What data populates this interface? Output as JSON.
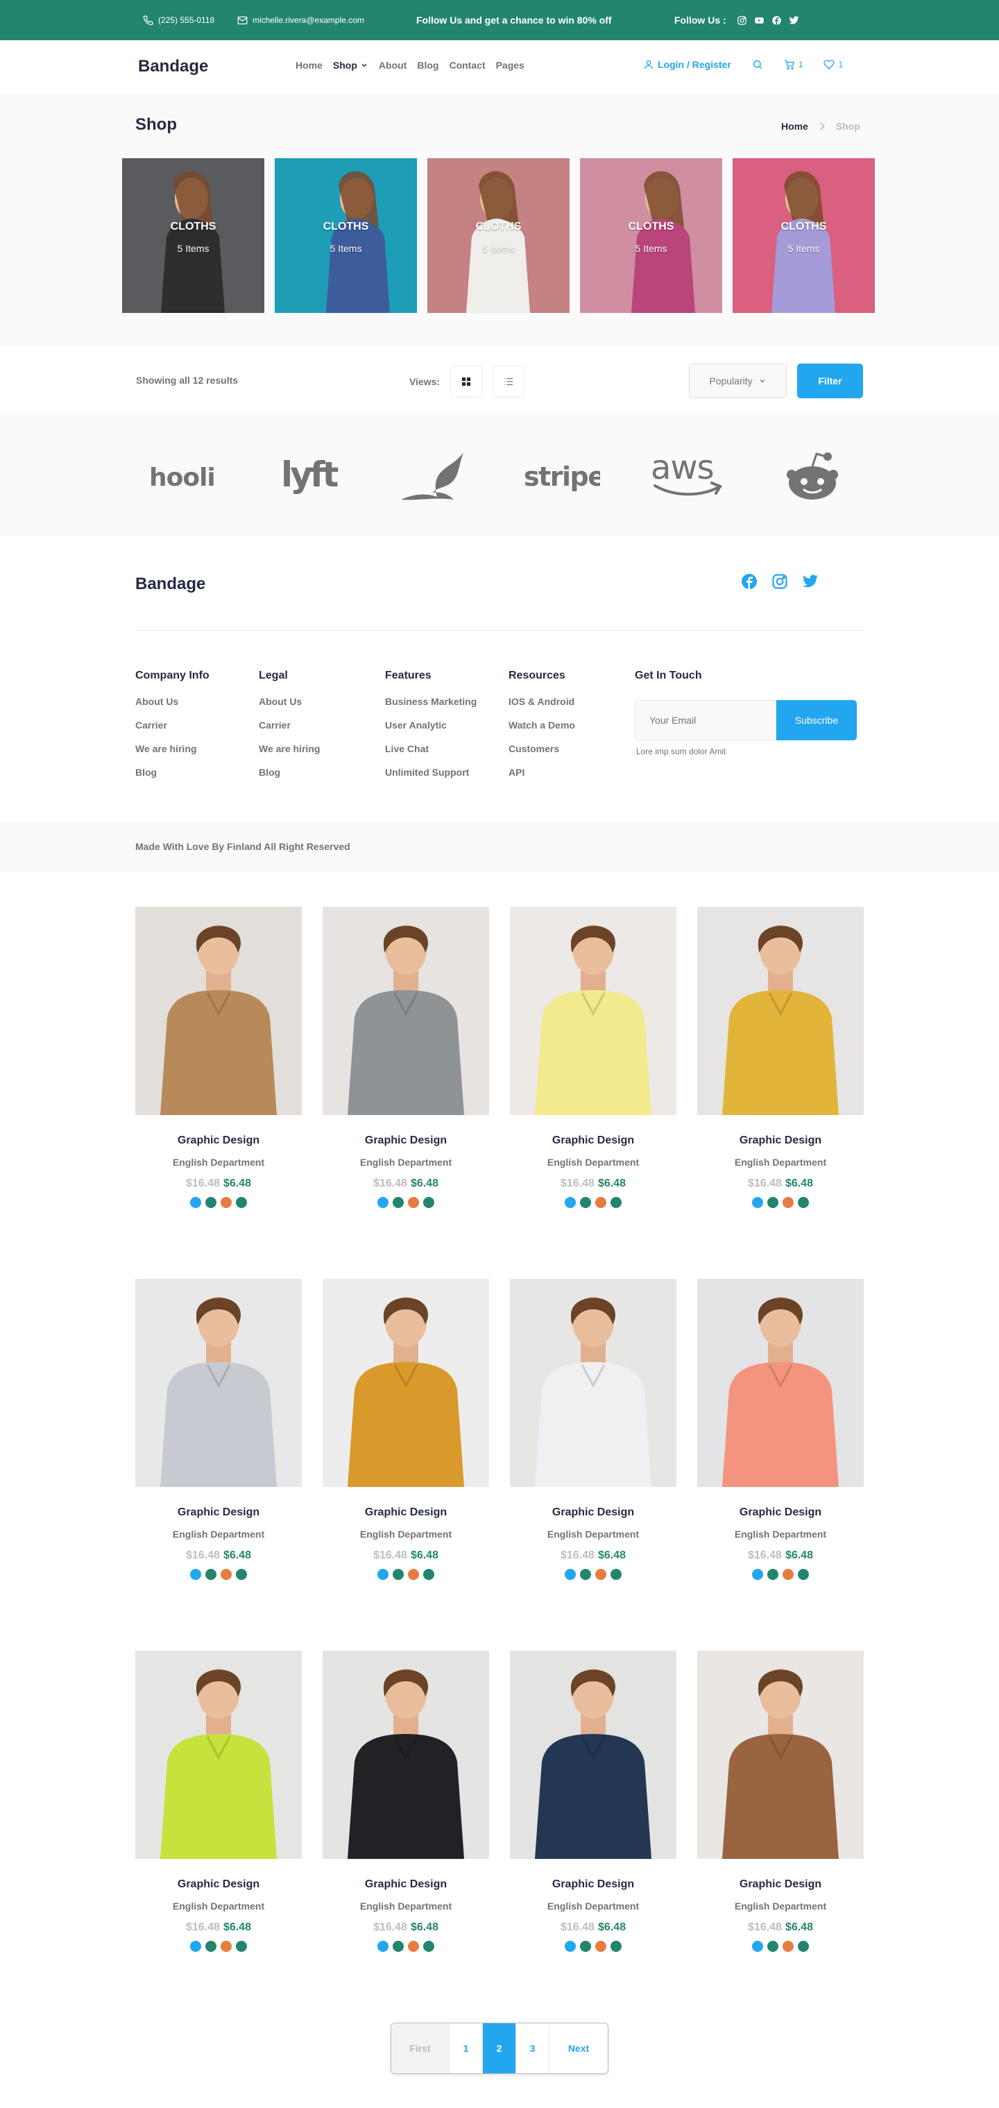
{
  "topbar": {
    "phone": "(225) 555-0118",
    "email": "michelle.rivera@example.com",
    "promo": "Follow Us  and get a chance to win 80% off",
    "follow": "Follow Us  :",
    "social_icons": [
      "instagram-icon",
      "youtube-icon",
      "facebook-icon",
      "twitter-icon"
    ]
  },
  "nav": {
    "brand": "Bandage",
    "items": [
      "Home",
      "Shop",
      "About",
      "Blog",
      "Contact",
      "Pages"
    ],
    "login": "Login / Register",
    "cart_count": "1",
    "wishlist_count": "1"
  },
  "hero": {
    "title": "Shop",
    "breadcrumb": [
      "Home",
      "Shop"
    ],
    "categories": [
      {
        "title": "CLOTHS",
        "count": "5 Items",
        "bg": "#5A5B5E"
      },
      {
        "title": "CLOTHS",
        "count": "5 Items",
        "bg": "#1E9DB6"
      },
      {
        "title": "CLOTHS",
        "count": "5 Items",
        "bg": "#C48282"
      },
      {
        "title": "CLOTHS",
        "count": "5 Items",
        "bg": "#D08FA0"
      },
      {
        "title": "CLOTHS",
        "count": "5 Items",
        "bg": "#D9607E"
      }
    ]
  },
  "filterbar": {
    "showing": "Showing all 12 results",
    "views_label": "Views:",
    "sort": "Popularity",
    "filter": "Filter"
  },
  "logos": [
    "hooli",
    "lyft",
    "leaf",
    "stripe",
    "aws",
    "reddit"
  ],
  "footer": {
    "brand": "Bandage",
    "columns": [
      {
        "title": "Company Info",
        "links": [
          "About Us",
          "Carrier",
          "We are hiring",
          "Blog"
        ]
      },
      {
        "title": "Legal",
        "links": [
          "About Us",
          "Carrier",
          "We are hiring",
          "Blog"
        ]
      },
      {
        "title": "Features",
        "links": [
          "Business Marketing",
          "User Analytic",
          "Live Chat",
          "Unlimited Support"
        ]
      },
      {
        "title": "Resources",
        "links": [
          "IOS & Android",
          "Watch a Demo",
          "Customers",
          "API"
        ]
      }
    ],
    "touch": {
      "title": "Get In Touch",
      "placeholder": "Your Email",
      "button": "Subscribe",
      "note": "Lore imp sum dolor Amit"
    },
    "copyright": "Made With Love By Finland All Right Reserved"
  },
  "products": [
    {
      "name": "Graphic Design",
      "dept": "English Department",
      "old": "$16.48",
      "price": "$6.48",
      "bg": "#E2DEDA",
      "garment": "#B88A5A"
    },
    {
      "name": "Graphic Design",
      "dept": "English Department",
      "old": "$16.48",
      "price": "$6.48",
      "bg": "#E6E3E1",
      "garment": "#8F9396"
    },
    {
      "name": "Graphic Design",
      "dept": "English Department",
      "old": "$16.48",
      "price": "$6.48",
      "bg": "#ECE9E6",
      "garment": "#F3EA8E"
    },
    {
      "name": "Graphic Design",
      "dept": "English Department",
      "old": "$16.48",
      "price": "$6.48",
      "bg": "#E6E5E3",
      "garment": "#E2B43A"
    },
    {
      "name": "Graphic Design",
      "dept": "English Department",
      "old": "$16.48",
      "price": "$6.48",
      "bg": "#E8E8E8",
      "garment": "#C7CBD1"
    },
    {
      "name": "Graphic Design",
      "dept": "English Department",
      "old": "$16.48",
      "price": "$6.48",
      "bg": "#EDEDED",
      "garment": "#D99A2B"
    },
    {
      "name": "Graphic Design",
      "dept": "English Department",
      "old": "$16.48",
      "price": "$6.48",
      "bg": "#E7E6E4",
      "garment": "#F0F0F2"
    },
    {
      "name": "Graphic Design",
      "dept": "English Department",
      "old": "$16.48",
      "price": "$6.48",
      "bg": "#E3E4E6",
      "garment": "#F4947E"
    },
    {
      "name": "Graphic Design",
      "dept": "English Department",
      "old": "$16.48",
      "price": "$6.48",
      "bg": "#E5E5E3",
      "garment": "#C6E23C"
    },
    {
      "name": "Graphic Design",
      "dept": "English Department",
      "old": "$16.48",
      "price": "$6.48",
      "bg": "#E4E4E2",
      "garment": "#222226"
    },
    {
      "name": "Graphic Design",
      "dept": "English Department",
      "old": "$16.48",
      "price": "$6.48",
      "bg": "#E3E3E1",
      "garment": "#233752"
    },
    {
      "name": "Graphic Design",
      "dept": "English Department",
      "old": "$16.48",
      "price": "$6.48",
      "bg": "#E9E6E3",
      "garment": "#9A6440"
    }
  ],
  "swatch_colors": [
    "#23A6F0",
    "#23856D",
    "#E77C40",
    "#23856D"
  ],
  "pagination": {
    "first": "First",
    "pages": [
      "1",
      "2",
      "3"
    ],
    "active": "2",
    "next": "Next"
  },
  "colors": {
    "primary": "#23A6F0",
    "secondary": "#23856D",
    "dark": "#252B42",
    "muted": "#737373"
  }
}
